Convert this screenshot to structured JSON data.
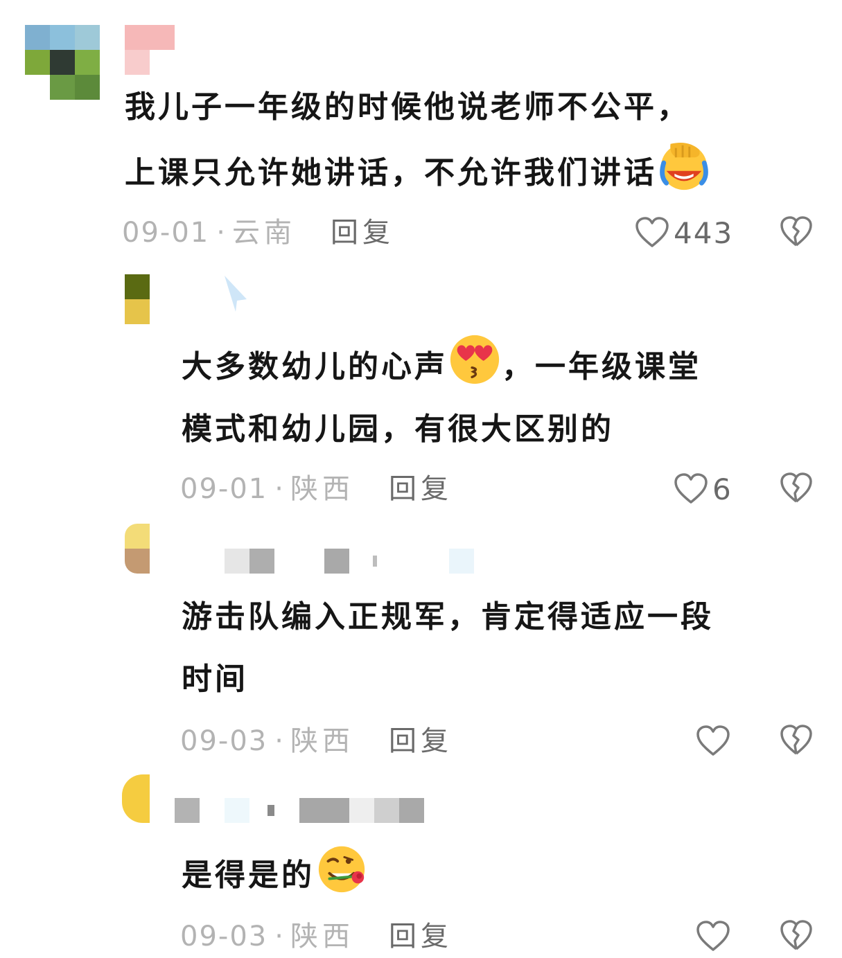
{
  "comments": [
    {
      "text_lines": [
        "我儿子一年级的时候他说老师不公平，",
        "上课只允许她讲话，不允许我们讲话"
      ],
      "emoji": "facepalm-laughing-emoji",
      "date": "09-01",
      "location": "云南",
      "reply_label": "回复",
      "likes": "443"
    },
    {
      "text_lines": [
        "大多数幼儿的心声",
        "，一年级课堂",
        "模式和幼儿园，有很大区别的"
      ],
      "emoji": "heart-eyes-kiss-emoji",
      "date": "09-01",
      "location": "陕西",
      "reply_label": "回复",
      "likes": "6"
    },
    {
      "text_lines": [
        "游击队编入正规军，肯定得适应一段",
        "时间"
      ],
      "date": "09-03",
      "location": "陕西",
      "reply_label": "回复",
      "likes": ""
    },
    {
      "text_lines": [
        "是得是的"
      ],
      "emoji": "wink-rose-emoji",
      "date": "09-03",
      "location": "陕西",
      "reply_label": "回复",
      "likes": ""
    }
  ],
  "separator": "·",
  "colors": {
    "text": "#161616",
    "meta": "#b3b3b3",
    "action": "#6a6a6a"
  },
  "icons": [
    "heart-outline-icon",
    "broken-heart-icon"
  ]
}
